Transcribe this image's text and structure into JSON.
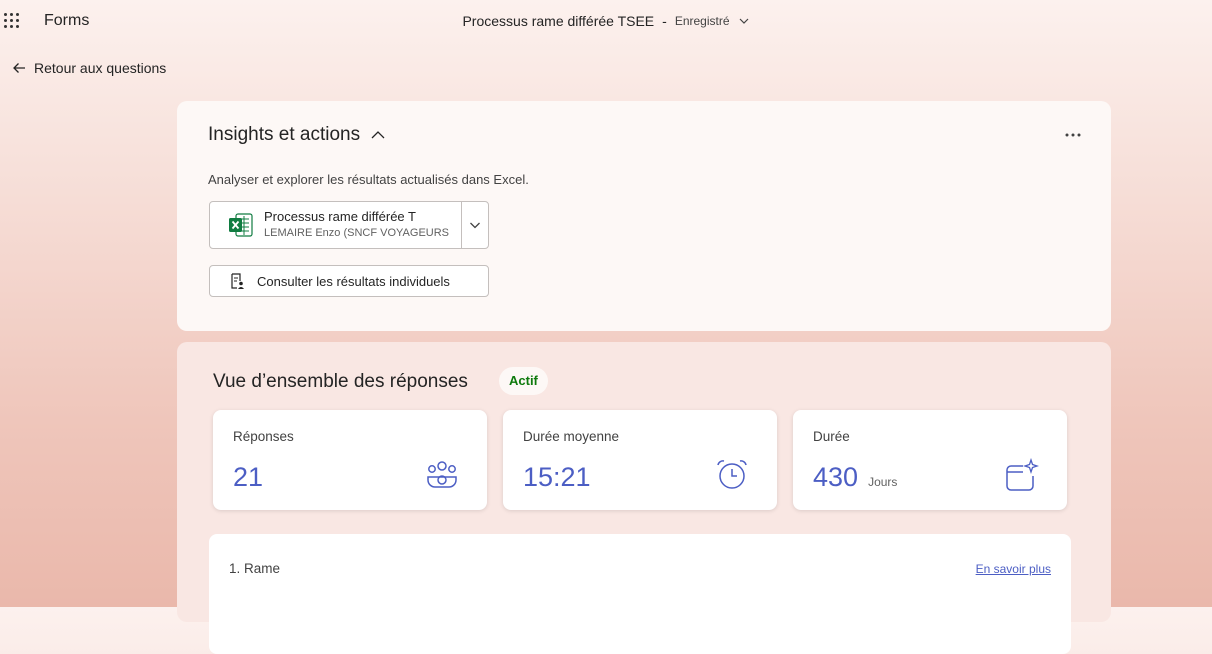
{
  "header": {
    "app_name": "Forms",
    "doc_title": "Processus rame différée TSEE",
    "separator": "-",
    "doc_status": "Enregistré"
  },
  "back_link": "Retour aux questions",
  "insights": {
    "title": "Insights et actions",
    "description": "Analyser et explorer les résultats actualisés dans Excel.",
    "excel_file_name": "Processus rame différée T",
    "excel_owner": "LEMAIRE Enzo (SNCF VOYAGEURS",
    "consult_label": "Consulter les résultats individuels"
  },
  "overview": {
    "title": "Vue d’ensemble des réponses",
    "status_badge": "Actif",
    "stats": [
      {
        "label": "Réponses",
        "value": "21",
        "unit": "",
        "icon": "people-icon"
      },
      {
        "label": "Durée moyenne",
        "value": "15:21",
        "unit": "",
        "icon": "alarm-clock-icon"
      },
      {
        "label": "Durée",
        "value": "430",
        "unit": "Jours",
        "icon": "calendar-sparkle-icon"
      }
    ]
  },
  "question": {
    "title": "1. Rame",
    "link": "En savoir plus"
  },
  "colors": {
    "accent": "#4c5ec4",
    "active_green": "#0e7a0d",
    "excel_green": "#107c41"
  }
}
